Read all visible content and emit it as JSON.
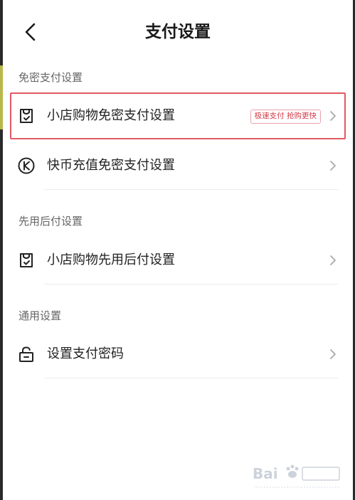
{
  "header": {
    "title": "支付设置"
  },
  "sections": {
    "secret_free": {
      "title": "免密支付设置"
    },
    "pay_later": {
      "title": "先用后付设置"
    },
    "general": {
      "title": "通用设置"
    }
  },
  "rows": {
    "shop_secret_free": {
      "label": "小店购物免密支付设置",
      "badge": "极速支付 抢购更快"
    },
    "coin_secret_free": {
      "label": "快币充值免密支付设置"
    },
    "shop_pay_later": {
      "label": "小店购物先用后付设置"
    },
    "set_password": {
      "label": "设置支付密码"
    }
  },
  "colors": {
    "highlight": "#e15a62",
    "badge_text": "#d23b47"
  }
}
